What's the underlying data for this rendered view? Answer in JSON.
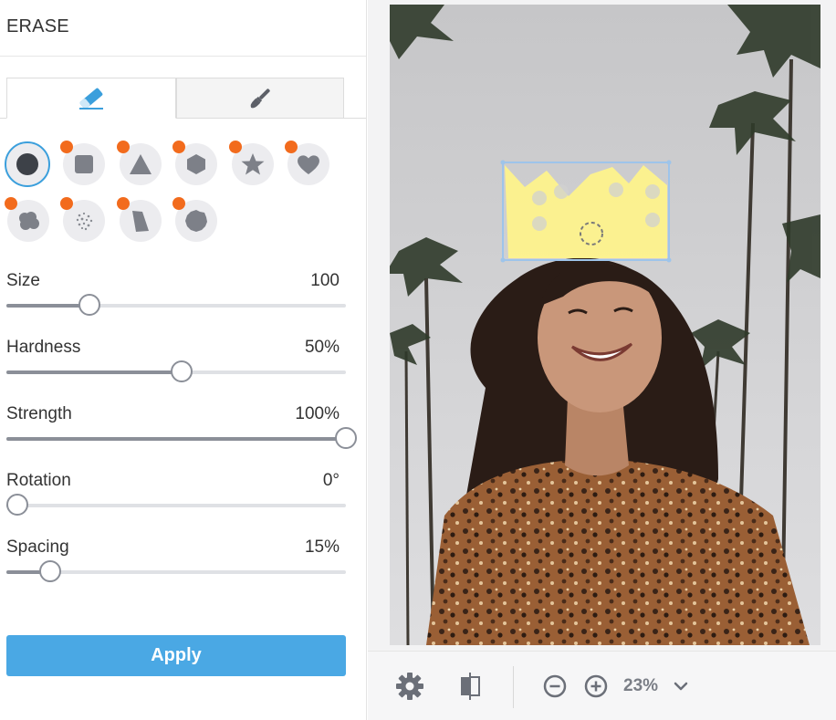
{
  "panel": {
    "title": "ERASE",
    "tabs": [
      {
        "icon": "eraser-icon",
        "active": true
      },
      {
        "icon": "paintbrush-icon",
        "active": false
      }
    ],
    "brushes": [
      {
        "name": "circle",
        "selected": true,
        "badge": false
      },
      {
        "name": "square",
        "selected": false,
        "badge": true
      },
      {
        "name": "triangle",
        "selected": false,
        "badge": true
      },
      {
        "name": "hexagon",
        "selected": false,
        "badge": true
      },
      {
        "name": "star",
        "selected": false,
        "badge": true
      },
      {
        "name": "heart",
        "selected": false,
        "badge": true
      },
      {
        "name": "cloud",
        "selected": false,
        "badge": true
      },
      {
        "name": "scatter",
        "selected": false,
        "badge": true
      },
      {
        "name": "quad",
        "selected": false,
        "badge": true
      },
      {
        "name": "blob",
        "selected": false,
        "badge": true
      }
    ],
    "sliders": [
      {
        "label": "Size",
        "value_text": "100",
        "level": 0.22
      },
      {
        "label": "Hardness",
        "value_text": "50%",
        "level": 0.5
      },
      {
        "label": "Strength",
        "value_text": "100%",
        "level": 1.0
      },
      {
        "label": "Rotation",
        "value_text": "0°",
        "level": 0.0
      },
      {
        "label": "Spacing",
        "value_text": "15%",
        "level": 0.1
      }
    ],
    "apply_label": "Apply"
  },
  "toolbar": {
    "settings_icon": "gear-icon",
    "compare_icon": "split-compare-icon",
    "zoom_out_icon": "zoom-out-icon",
    "zoom_in_icon": "zoom-in-icon",
    "zoom_level": "23%",
    "zoom_menu_icon": "chevron-down-icon"
  },
  "colors": {
    "accent": "#4aa8e4",
    "badge": "#f26b1d",
    "crown": "#fff48a"
  }
}
